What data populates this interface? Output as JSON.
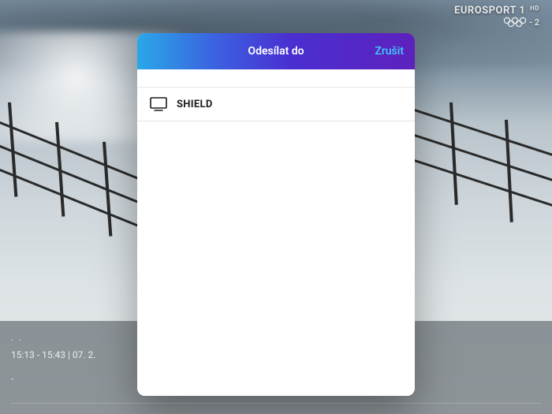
{
  "channel_bug": {
    "name": "EUROSPORT",
    "number": "1",
    "hd": "HD",
    "subnumber": "- 2"
  },
  "infobar": {
    "dots": ". .",
    "time_range": "15:13 - 15:43 | 07. 2.",
    "secondary": "-"
  },
  "modal": {
    "title": "Odesílat do",
    "cancel": "Zrušit",
    "devices": [
      {
        "name": "SHIELD",
        "icon": "tv-icon"
      }
    ]
  }
}
